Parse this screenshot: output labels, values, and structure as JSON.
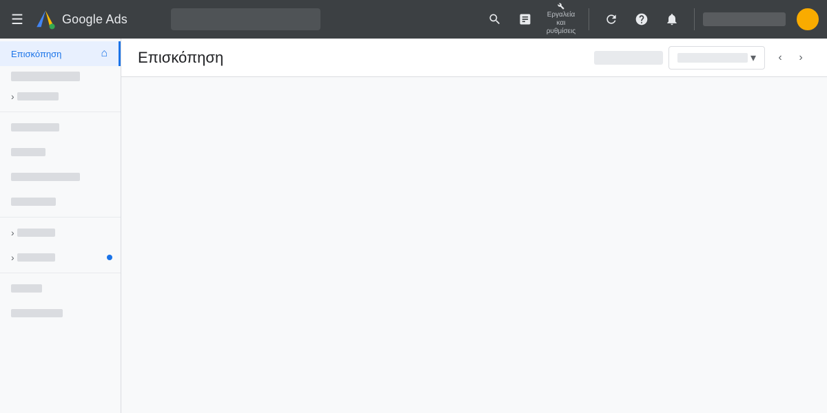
{
  "app": {
    "title": "Google Ads",
    "logo_alt": "Google Ads logo"
  },
  "header": {
    "search_placeholder": "",
    "tools_label": "Εργαλεία",
    "settings_label": "και ρυθμίσεις",
    "account_bar": ""
  },
  "sidebar": {
    "active_item": "Επισκόπηση",
    "items": [
      {
        "label": "Επισκόπηση",
        "active": true,
        "has_home": true
      },
      {
        "label": "",
        "indent": false,
        "expandable": false
      },
      {
        "label": "",
        "expandable": true
      },
      {
        "label": "",
        "expandable": false
      },
      {
        "label": "",
        "expandable": false
      },
      {
        "label": "",
        "expandable": false
      },
      {
        "label": "",
        "expandable": false
      },
      {
        "label": "",
        "expandable": true
      },
      {
        "label": "",
        "expandable": true,
        "has_dot": true
      },
      {
        "label": "",
        "expandable": false
      },
      {
        "label": "",
        "expandable": false
      }
    ]
  },
  "main": {
    "page_title": "Επισκόπηση",
    "dropdown_placeholder": ""
  },
  "icons": {
    "hamburger": "☰",
    "search": "🔍",
    "chart": "📊",
    "tools": "🔧",
    "refresh": "↻",
    "help": "?",
    "bell": "🔔",
    "chevron_down": "▾",
    "chevron_left": "‹",
    "chevron_right": "›",
    "home": "⌂",
    "expand": "›"
  }
}
